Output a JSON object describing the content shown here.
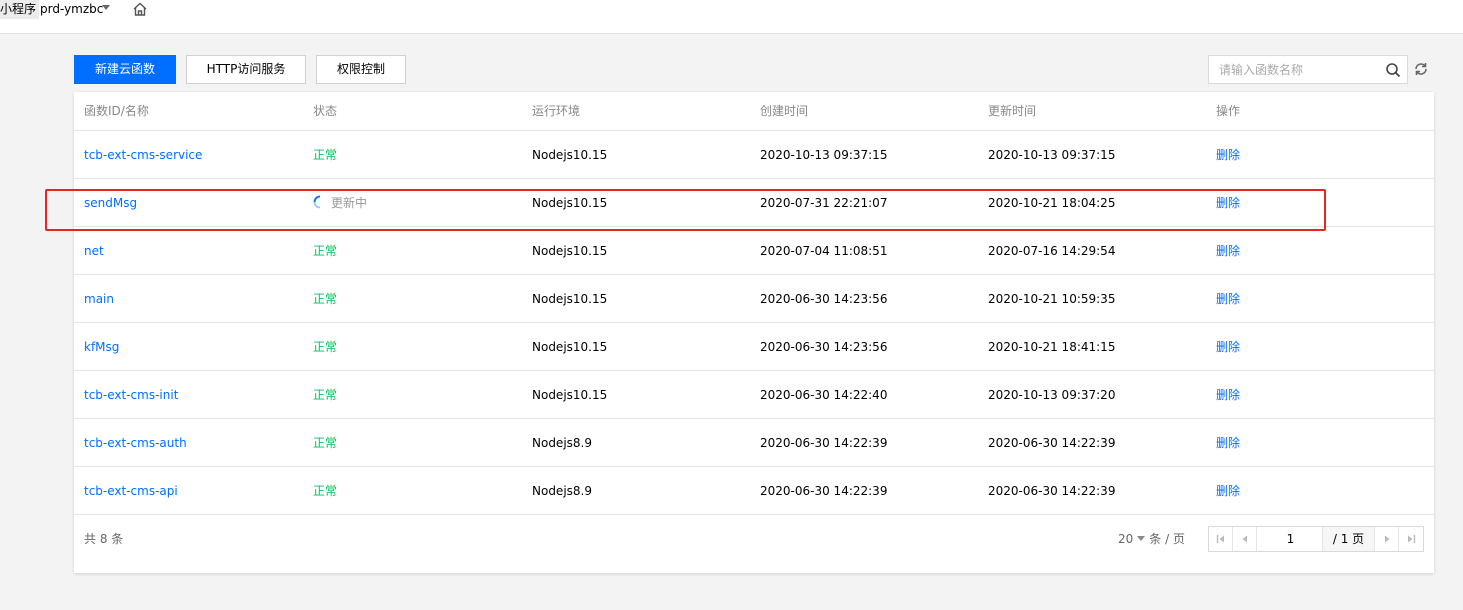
{
  "topbar": {
    "app_label": "小程序",
    "env_name": "prd-ymzbc"
  },
  "toolbar": {
    "new_function_label": "新建云函数",
    "http_service_label": "HTTP访问服务",
    "permission_label": "权限控制",
    "search_placeholder": "请输入函数名称"
  },
  "table": {
    "headers": {
      "name": "函数ID/名称",
      "status": "状态",
      "runtime": "运行环境",
      "created": "创建时间",
      "updated": "更新时间",
      "action": "操作"
    },
    "rows": [
      {
        "name": "tcb-ext-cms-service",
        "status": "正常",
        "runtime": "Nodejs10.15",
        "created": "2020-10-13 09:37:15",
        "updated": "2020-10-13 09:37:15",
        "action": "删除"
      },
      {
        "name": "sendMsg",
        "status": "更新中",
        "runtime": "Nodejs10.15",
        "created": "2020-07-31 22:21:07",
        "updated": "2020-10-21 18:04:25",
        "action": "删除"
      },
      {
        "name": "net",
        "status": "正常",
        "runtime": "Nodejs10.15",
        "created": "2020-07-04 11:08:51",
        "updated": "2020-07-16 14:29:54",
        "action": "删除"
      },
      {
        "name": "main",
        "status": "正常",
        "runtime": "Nodejs10.15",
        "created": "2020-06-30 14:23:56",
        "updated": "2020-10-21 10:59:35",
        "action": "删除"
      },
      {
        "name": "kfMsg",
        "status": "正常",
        "runtime": "Nodejs10.15",
        "created": "2020-06-30 14:23:56",
        "updated": "2020-10-21 18:41:15",
        "action": "删除"
      },
      {
        "name": "tcb-ext-cms-init",
        "status": "正常",
        "runtime": "Nodejs10.15",
        "created": "2020-06-30 14:22:40",
        "updated": "2020-10-13 09:37:20",
        "action": "删除"
      },
      {
        "name": "tcb-ext-cms-auth",
        "status": "正常",
        "runtime": "Nodejs8.9",
        "created": "2020-06-30 14:22:39",
        "updated": "2020-06-30 14:22:39",
        "action": "删除"
      },
      {
        "name": "tcb-ext-cms-api",
        "status": "正常",
        "runtime": "Nodejs8.9",
        "created": "2020-06-30 14:22:39",
        "updated": "2020-06-30 14:22:39",
        "action": "删除"
      }
    ]
  },
  "footer": {
    "total_text": "共 8 条",
    "page_size": "20",
    "page_size_unit": "条 / 页",
    "current_page": "1",
    "total_pages": "/ 1 页"
  },
  "colors": {
    "primary": "#006eff",
    "status_ok": "#0abf5b",
    "highlight": "#e82525"
  }
}
